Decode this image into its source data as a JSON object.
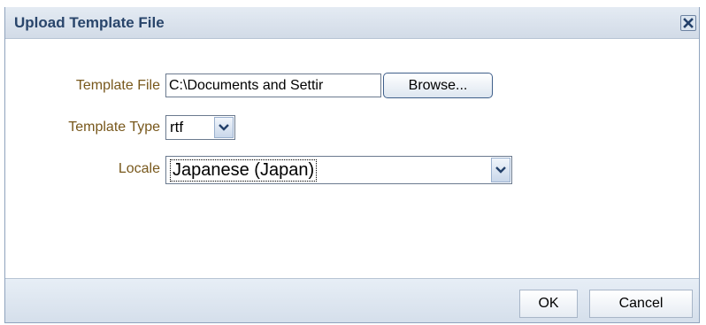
{
  "dialog": {
    "title": "Upload Template File"
  },
  "form": {
    "template_file_label": "Template File",
    "template_file_value": "C:\\Documents and Settir",
    "browse_label": "Browse...",
    "template_type_label": "Template Type",
    "template_type_value": "rtf",
    "locale_label": "Locale",
    "locale_value": "Japanese (Japan)"
  },
  "footer": {
    "ok_label": "OK",
    "cancel_label": "Cancel"
  },
  "icons": {
    "close": "close-icon",
    "dropdown": "chevron-down-icon"
  },
  "colors": {
    "title_text": "#29456b",
    "label_text": "#78581c",
    "titlebar_bg": "#d2dbe7",
    "footer_bg": "#d5dfeb"
  }
}
